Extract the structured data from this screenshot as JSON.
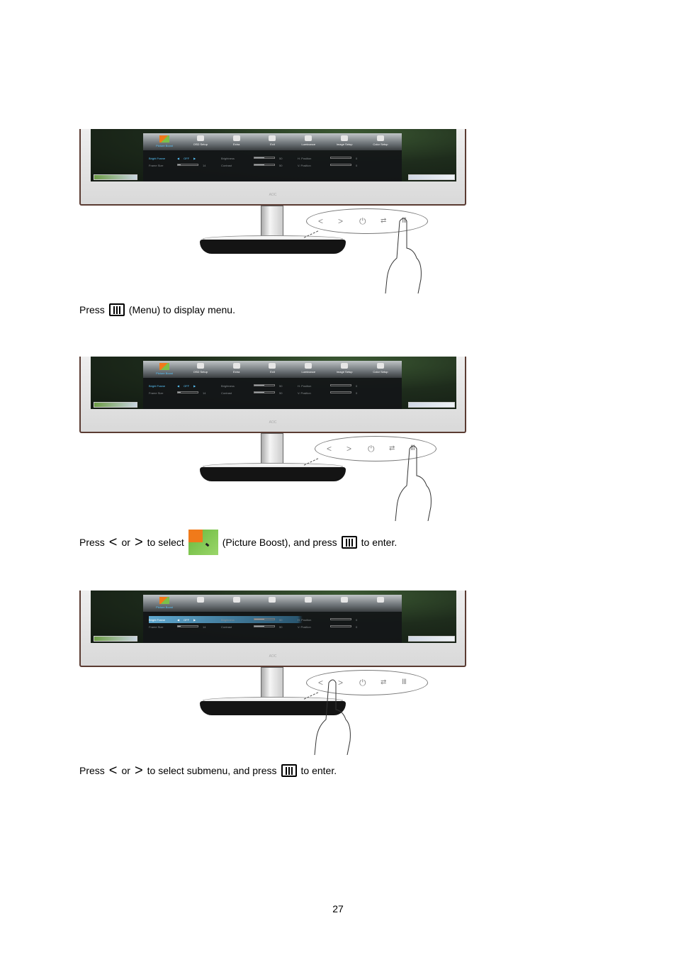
{
  "osd": {
    "tabs": [
      {
        "label": "Picture Boost",
        "icon": "picture-boost-icon"
      },
      {
        "label": "OSD Setup",
        "icon": "osd-setup-icon"
      },
      {
        "label": "Extra",
        "icon": "extra-icon"
      },
      {
        "label": "Exit",
        "icon": "exit-icon"
      },
      {
        "label": "Luminance",
        "icon": "luminance-icon"
      },
      {
        "label": "Image Setup",
        "icon": "image-setup-icon"
      },
      {
        "label": "Color Setup",
        "icon": "color-setup-icon"
      }
    ],
    "rows": [
      {
        "label": "Bright Frame",
        "value": "OFF",
        "mid_label": "Brightness",
        "mid_value": "50",
        "right_label": "H. Position",
        "right_value": "0"
      },
      {
        "label": "Frame Size",
        "value": "14",
        "mid_label": "Contrast",
        "mid_value": "50",
        "right_label": "V. Position",
        "right_value": "0"
      }
    ],
    "brand": "AOC"
  },
  "buttons": {
    "left": "<",
    "right": ">",
    "power": "⏻",
    "source": "⇄",
    "menu": "Ⅲ"
  },
  "captions": {
    "step1": {
      "press": "Press",
      "text": "(Menu) to display menu."
    },
    "step2": {
      "press": "Press",
      "or": "or",
      "to_select": "to select",
      "item": "(Picture Boost), and press",
      "enter": "to enter."
    },
    "step3": {
      "press": "Press",
      "or": "or",
      "to_select": "to select submenu, and press",
      "enter": "to enter."
    }
  },
  "glyphs": {
    "left_arrow": "<",
    "right_arrow": ">"
  },
  "page_number": "27"
}
